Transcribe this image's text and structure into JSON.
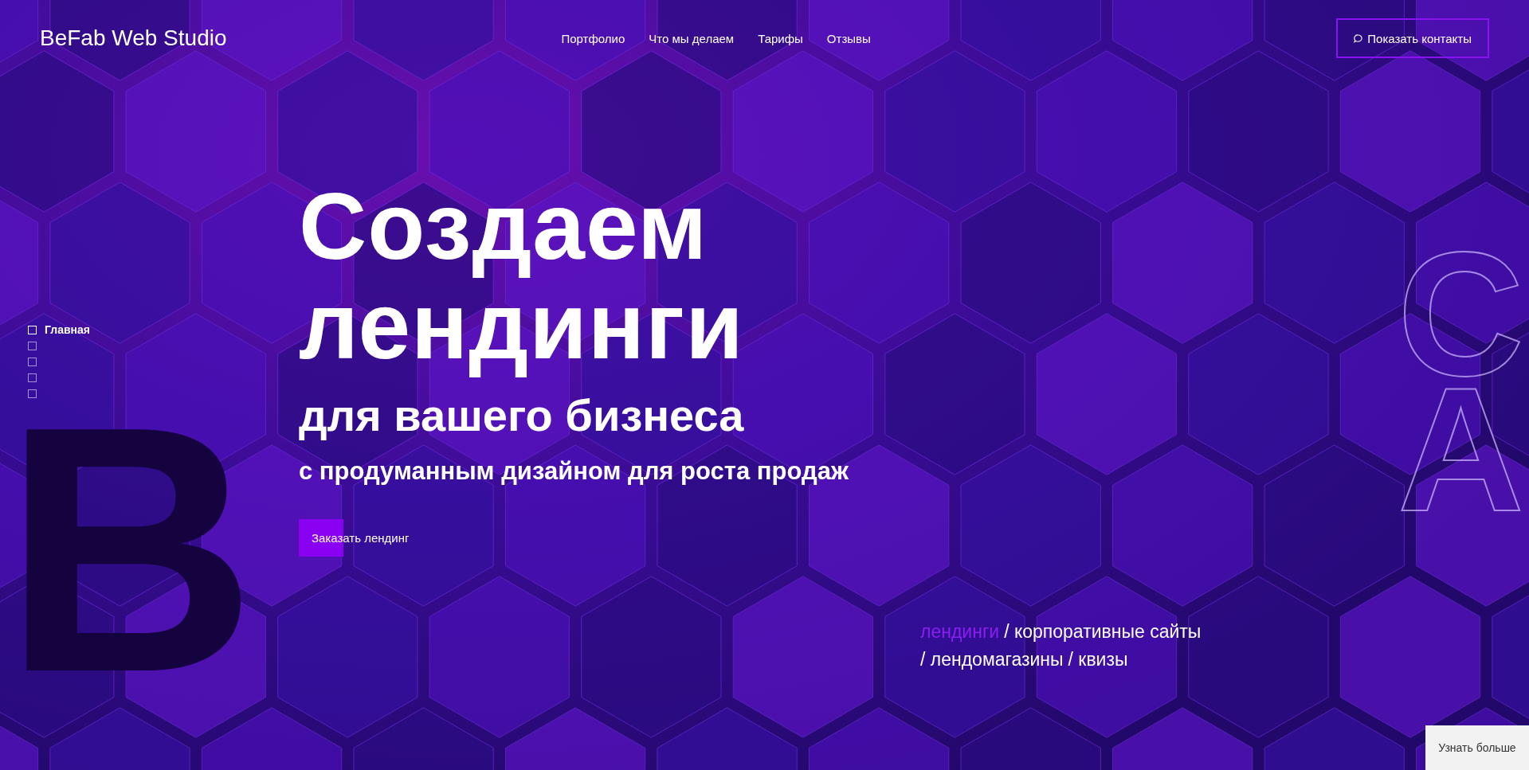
{
  "header": {
    "logo": "BeFab Web Studio",
    "nav": [
      "Портфолио",
      "Что мы делаем",
      "Тарифы",
      "Отзывы"
    ],
    "contact_button": "Показать контакты"
  },
  "side_nav": [
    {
      "label": "Главная",
      "selected": true
    },
    {
      "selected": false
    },
    {
      "selected": false
    },
    {
      "selected": false
    },
    {
      "selected": false
    }
  ],
  "hero": {
    "title_lines": [
      "Создаем",
      "лендинги"
    ],
    "subtitle": "для вашего бизнеса",
    "tagline": "с продуманным дизайном для роста продаж",
    "cta": "Заказать лендинг"
  },
  "decor": {
    "left_letter": "B",
    "right_letters": [
      "C",
      "A"
    ]
  },
  "services": [
    [
      {
        "label": "лендинги",
        "selected": true
      },
      {
        "label": "/ корпоративные сайты",
        "selected": false
      }
    ],
    [
      {
        "label": "/ лендомагазины",
        "selected": false
      },
      {
        "label": "/ квизы",
        "selected": false
      }
    ]
  ],
  "more_button": "Узнать больше"
}
